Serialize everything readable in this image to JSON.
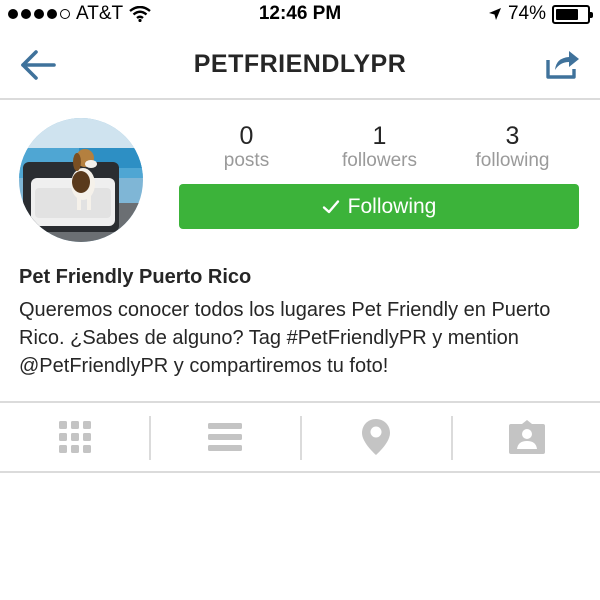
{
  "status_bar": {
    "carrier": "AT&T",
    "time": "12:46 PM",
    "battery_percent": "74%",
    "battery_level": 0.74,
    "signal_bars": 4,
    "icons": [
      "wifi-icon",
      "location-arrow-icon",
      "battery-icon"
    ]
  },
  "nav": {
    "title": "PETFRIENDLYPR",
    "back_icon": "back-arrow-icon",
    "share_icon": "share-icon"
  },
  "profile": {
    "stats": [
      {
        "value": "0",
        "label": "posts"
      },
      {
        "value": "1",
        "label": "followers"
      },
      {
        "value": "3",
        "label": "following"
      }
    ],
    "follow_button_label": "Following",
    "name": "Pet Friendly Puerto Rico",
    "bio": "Queremos conocer todos los lugares Pet Friendly en Puerto Rico. ¿Sabes de alguno? Tag #PetFriendlyPR y mention @PetFriendlyPR y compartiremos tu foto!"
  },
  "tabs": [
    {
      "icon": "grid-icon"
    },
    {
      "icon": "list-icon"
    },
    {
      "icon": "location-pin-icon"
    },
    {
      "icon": "tagged-photos-icon"
    }
  ],
  "colors": {
    "accent_blue": "#3f729b",
    "following_green": "#3cb33a",
    "muted_gray": "#9a9a9a",
    "icon_gray": "#c4c4c4",
    "divider": "#dbdbdb"
  }
}
